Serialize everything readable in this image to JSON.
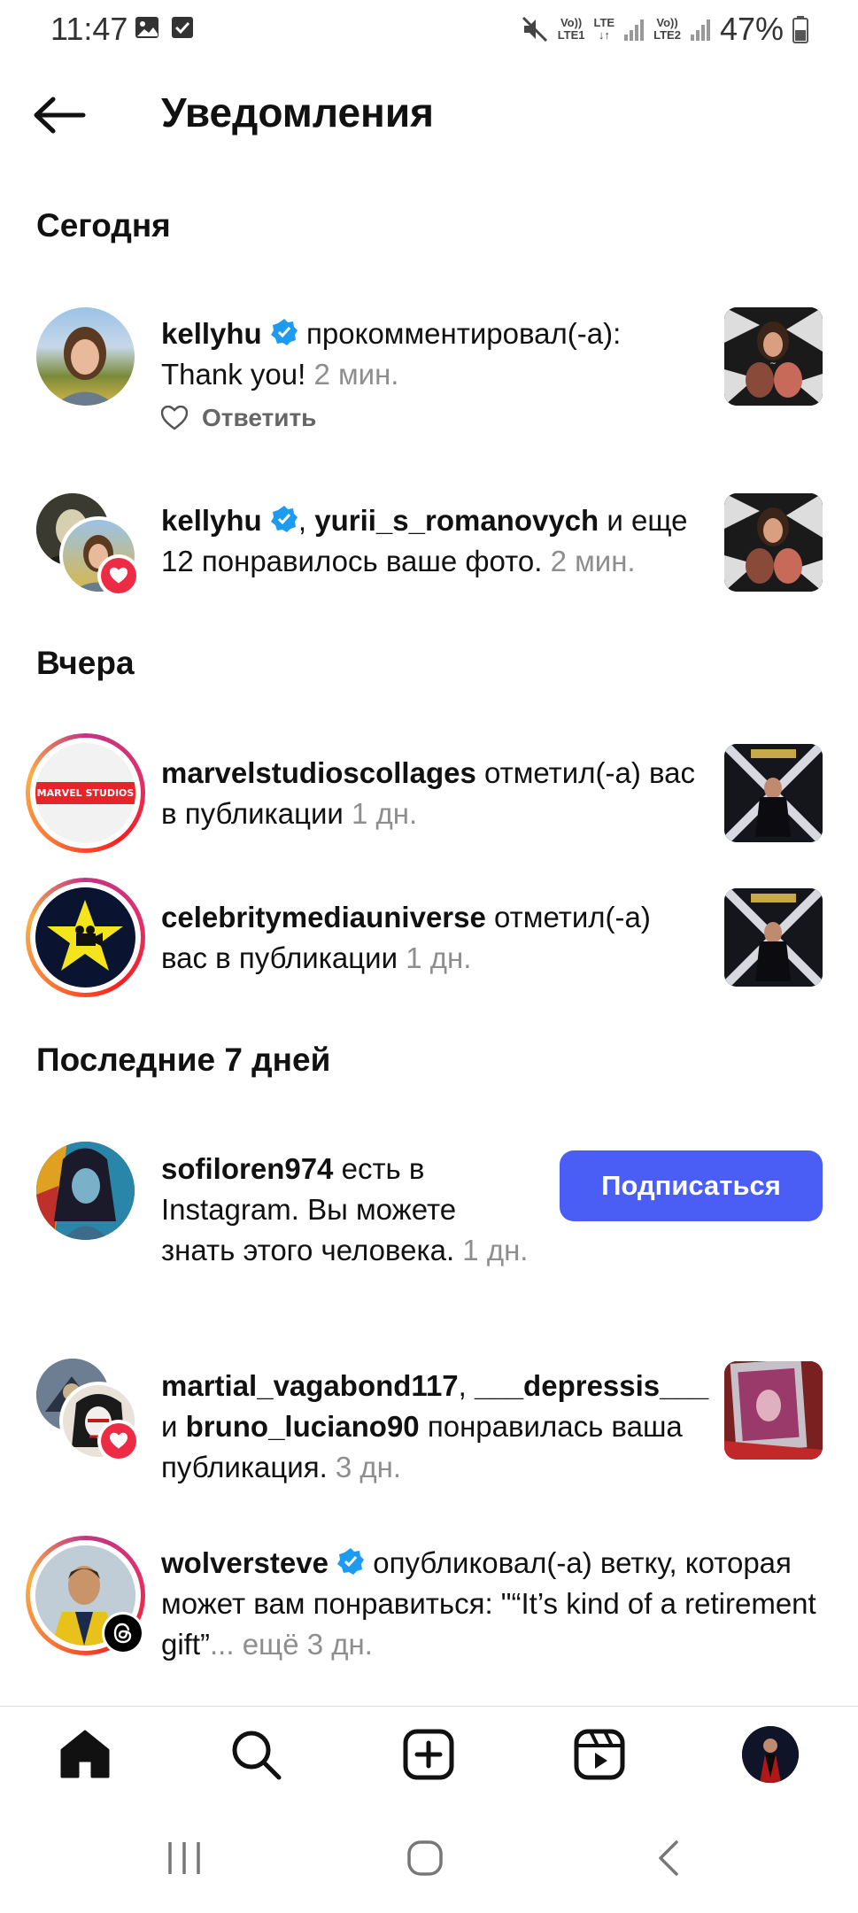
{
  "status_bar": {
    "time": "11:47",
    "net1_top": "Vo))",
    "net1_bottom": "LTE1",
    "lte": "LTE",
    "net2_top": "Vo))",
    "net2_bottom": "LTE2",
    "battery": "47%"
  },
  "header": {
    "title": "Уведомления"
  },
  "sections": {
    "today": "Сегодня",
    "yesterday": "Вчера",
    "last7": "Последние 7 дней"
  },
  "notifications": {
    "n1": {
      "user": "kellyhu",
      "action": " прокомментировал(-а): Thank you! ",
      "time": "2 мин.",
      "reply": "Ответить"
    },
    "n2": {
      "user1": "kellyhu",
      "sep": ", ",
      "user2": "yurii_s_romanovych",
      "action": " и еще 12 понравилось ваше фото. ",
      "time": "2 мин."
    },
    "n3": {
      "user": "marvelstudioscollages",
      "action": " отметил(-а) вас в публикации ",
      "time": "1 дн.",
      "avatar_text": "MARVEL STUDIOS"
    },
    "n4": {
      "user": "celebritymediauniverse",
      "action": " отметил(-а) вас в публикации ",
      "time": "1 дн."
    },
    "n5": {
      "user": "sofiloren974",
      "action": " есть в Instagram. Вы можете знать этого человека. ",
      "time": "1 дн.",
      "button": "Подписаться"
    },
    "n6": {
      "user1": "martial_vagabond117",
      "sep": ", ",
      "user2": "___depressis___",
      "and": " и ",
      "user3": "bruno_luciano90",
      "action": " понравилась ваша публикация. ",
      "time": "3 дн."
    },
    "n7": {
      "user": "wolversteve",
      "action": " опубликовал(-а) ветку, которая может вам понравиться: \"“It’s kind of a retirement gift”",
      "more": "... ещё ",
      "time": "3 дн."
    }
  },
  "icons": {
    "back": "arrow-left-icon",
    "home": "home-icon",
    "search": "search-icon",
    "create": "plus-square-icon",
    "reels": "reels-icon",
    "profile": "profile-avatar"
  },
  "colors": {
    "accent": "#4a5ef5",
    "verified": "#1d9bf0",
    "heart": "#ed2b45"
  }
}
